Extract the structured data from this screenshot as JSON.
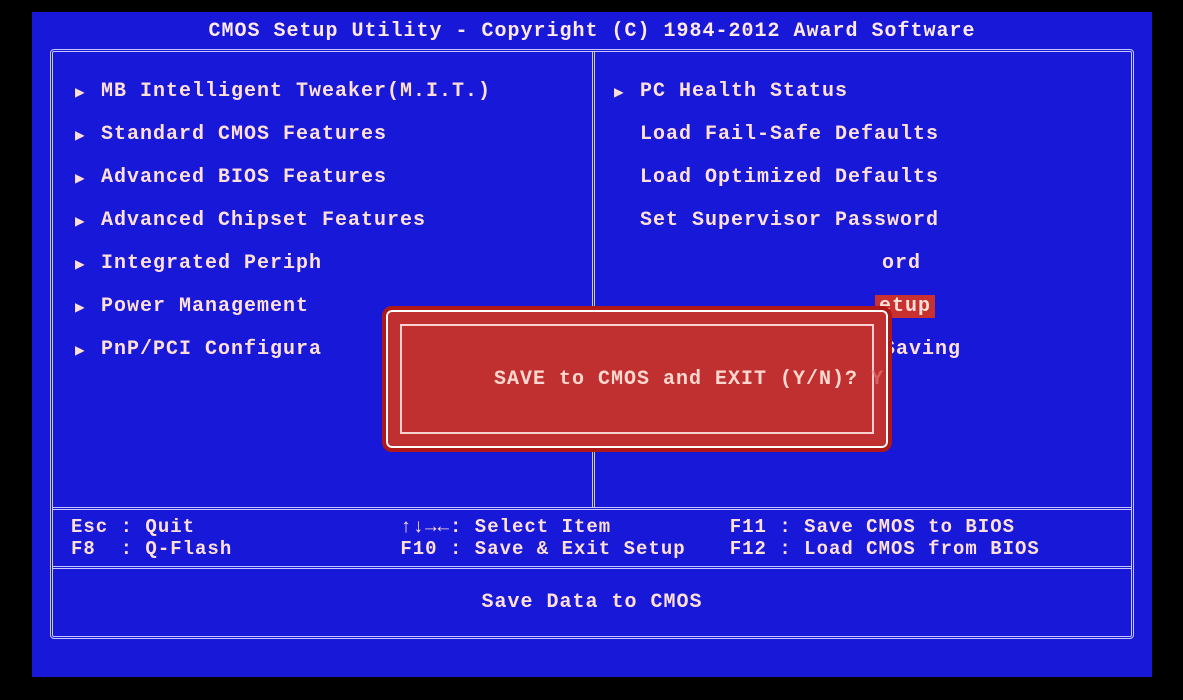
{
  "title": "CMOS Setup Utility - Copyright (C) 1984-2012 Award Software",
  "left_menu": [
    {
      "arrow": true,
      "label": "MB Intelligent Tweaker(M.I.T.)"
    },
    {
      "arrow": true,
      "label": "Standard CMOS Features"
    },
    {
      "arrow": true,
      "label": "Advanced BIOS Features"
    },
    {
      "arrow": true,
      "label": "Advanced Chipset Features"
    },
    {
      "arrow": true,
      "label": "Integrated Periph"
    },
    {
      "arrow": true,
      "label": "Power Management"
    },
    {
      "arrow": true,
      "label": "PnP/PCI Configura"
    }
  ],
  "right_menu": [
    {
      "arrow": true,
      "label": "PC Health Status",
      "tail": ""
    },
    {
      "arrow": false,
      "label": "Load Fail-Safe Defaults",
      "tail": ""
    },
    {
      "arrow": false,
      "label": "Load Optimized Defaults",
      "tail": ""
    },
    {
      "arrow": false,
      "label": "Set Supervisor Password",
      "tail": ""
    },
    {
      "arrow": false,
      "label": "",
      "tail": "ord"
    },
    {
      "arrow": false,
      "label": "",
      "tail": "etup",
      "highlight": true
    },
    {
      "arrow": false,
      "label": "",
      "tail": "Saving"
    }
  ],
  "hints": {
    "col1": "Esc : Quit\nF8  : Q-Flash",
    "col2": "↑↓→←: Select Item\nF10 : Save & Exit Setup",
    "col3": "F11 : Save CMOS to BIOS\nF12 : Load CMOS from BIOS"
  },
  "help": "Save Data to CMOS",
  "dialog": {
    "prompt": "SAVE to CMOS and EXIT (Y/N)? ",
    "input": "Y"
  }
}
